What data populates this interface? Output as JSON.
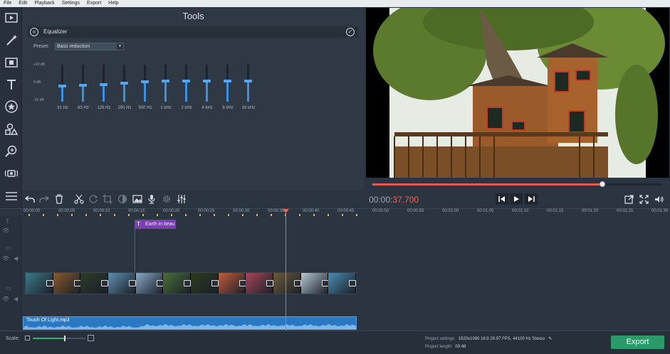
{
  "menu": [
    "File",
    "Edit",
    "Playback",
    "Settings",
    "Export",
    "Help"
  ],
  "tools": {
    "title": "Tools",
    "panel_title": "Equalizer",
    "preset_label": "Preset:",
    "preset_value": "Bass reduction",
    "db_labels": [
      "+20 dB",
      "0 dB",
      "-20 dB"
    ],
    "bands": [
      {
        "freq": "31 Hz",
        "level": 0.43
      },
      {
        "freq": "63 Hz",
        "level": 0.44
      },
      {
        "freq": "125 Hz",
        "level": 0.47
      },
      {
        "freq": "250 Hz",
        "level": 0.5
      },
      {
        "freq": "500 Hz",
        "level": 0.53
      },
      {
        "freq": "1 kHz",
        "level": 0.55
      },
      {
        "freq": "2 kHz",
        "level": 0.55
      },
      {
        "freq": "4 kHz",
        "level": 0.55
      },
      {
        "freq": "8 kHz",
        "level": 0.55
      },
      {
        "freq": "16 kHz",
        "level": 0.55
      }
    ]
  },
  "playback": {
    "time_main": "00:00:",
    "time_frac": "37.700",
    "progress": 0.794
  },
  "timeline": {
    "ticks": [
      "00:00:00",
      "00:00:05",
      "00:00:10",
      "00:00:15",
      "00:00:20",
      "00:00:25",
      "00:00:30",
      "00:00:35",
      "00:00:40",
      "00:00:45",
      "00:00:50",
      "00:00:55",
      "00:01:00",
      "00:01:05",
      "00:01:10",
      "00:01:15",
      "00:01:20",
      "00:01:25",
      "00:01:30"
    ],
    "title_clip": "Earth in beau",
    "audio_clip": "Touch Of Light.mp3",
    "clip_colors": [
      "#3a7b8c",
      "#8a5a2b",
      "#2d3b2a",
      "#5f8fb0",
      "#87a9c9",
      "#4b6e3a",
      "#2e3a1f",
      "#c45c3b",
      "#a8465a",
      "#6b5a3a",
      "#b7c8d4",
      "#4a8cb5"
    ]
  },
  "bottom": {
    "scale_label": "Scale:",
    "settings_label": "Project settings:",
    "settings_value": "1920x1080 16:9 29.97 FPS, 44100 Hz Stereo",
    "length_label": "Project length:",
    "length_value": "00:48",
    "export_label": "Export"
  },
  "colors": {
    "accent": "#e8694f",
    "eq": "#3d8fe0",
    "export": "#2a9a6a",
    "title_clip": "#7a3fb0"
  }
}
